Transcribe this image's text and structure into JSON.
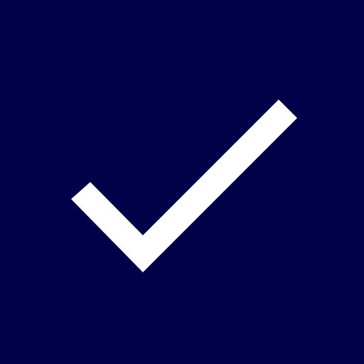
{
  "icon": {
    "name": "checkmark-icon",
    "background_color": "#020049",
    "mark_color": "#FFFFFF"
  }
}
